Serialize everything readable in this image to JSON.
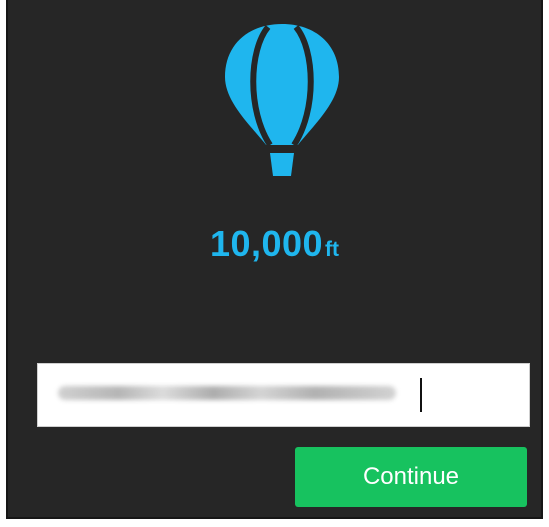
{
  "header": {
    "icon": "hot-air-balloon-icon",
    "accent_color": "#1fb6ee"
  },
  "altitude": {
    "value": "10,000",
    "unit": "ft"
  },
  "input": {
    "value": "",
    "placeholder": ""
  },
  "actions": {
    "continue_label": "Continue",
    "continue_color": "#17c25f"
  }
}
